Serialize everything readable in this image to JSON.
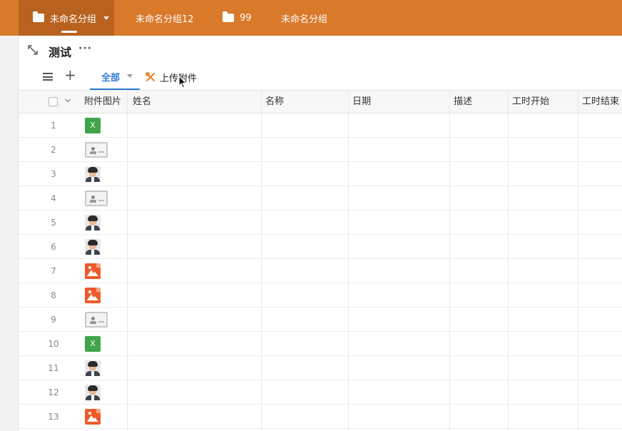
{
  "top_tabs": [
    {
      "label": "未命名分组",
      "active": true,
      "folder": true,
      "caret": true
    },
    {
      "label": "未命名分组12",
      "active": false,
      "folder": false,
      "caret": false
    },
    {
      "label": "99",
      "active": false,
      "folder": true,
      "caret": false
    },
    {
      "label": "未命名分组",
      "active": false,
      "folder": false,
      "caret": false
    }
  ],
  "page": {
    "title": "测试",
    "more": "···"
  },
  "toolbar": {
    "add": "+",
    "view_tab": "全部",
    "upload_label": "上传附件"
  },
  "table": {
    "columns": [
      "附件图片",
      "姓名",
      "名称",
      "日期",
      "描述",
      "工时开始",
      "工时结束"
    ],
    "rows": [
      {
        "num": "1",
        "type": "excel"
      },
      {
        "num": "2",
        "type": "card"
      },
      {
        "num": "3",
        "type": "face"
      },
      {
        "num": "4",
        "type": "card"
      },
      {
        "num": "5",
        "type": "face"
      },
      {
        "num": "6",
        "type": "face"
      },
      {
        "num": "7",
        "type": "image"
      },
      {
        "num": "8",
        "type": "image"
      },
      {
        "num": "9",
        "type": "card"
      },
      {
        "num": "10",
        "type": "excel"
      },
      {
        "num": "11",
        "type": "face"
      },
      {
        "num": "12",
        "type": "face"
      },
      {
        "num": "13",
        "type": "image"
      }
    ],
    "excel_letter": "X"
  },
  "colors": {
    "topbar": "#d9792a",
    "active_tab": "#b9621f",
    "accent": "#2f7cd6",
    "excel": "#3fa54a",
    "image": "#ef5a2a"
  }
}
